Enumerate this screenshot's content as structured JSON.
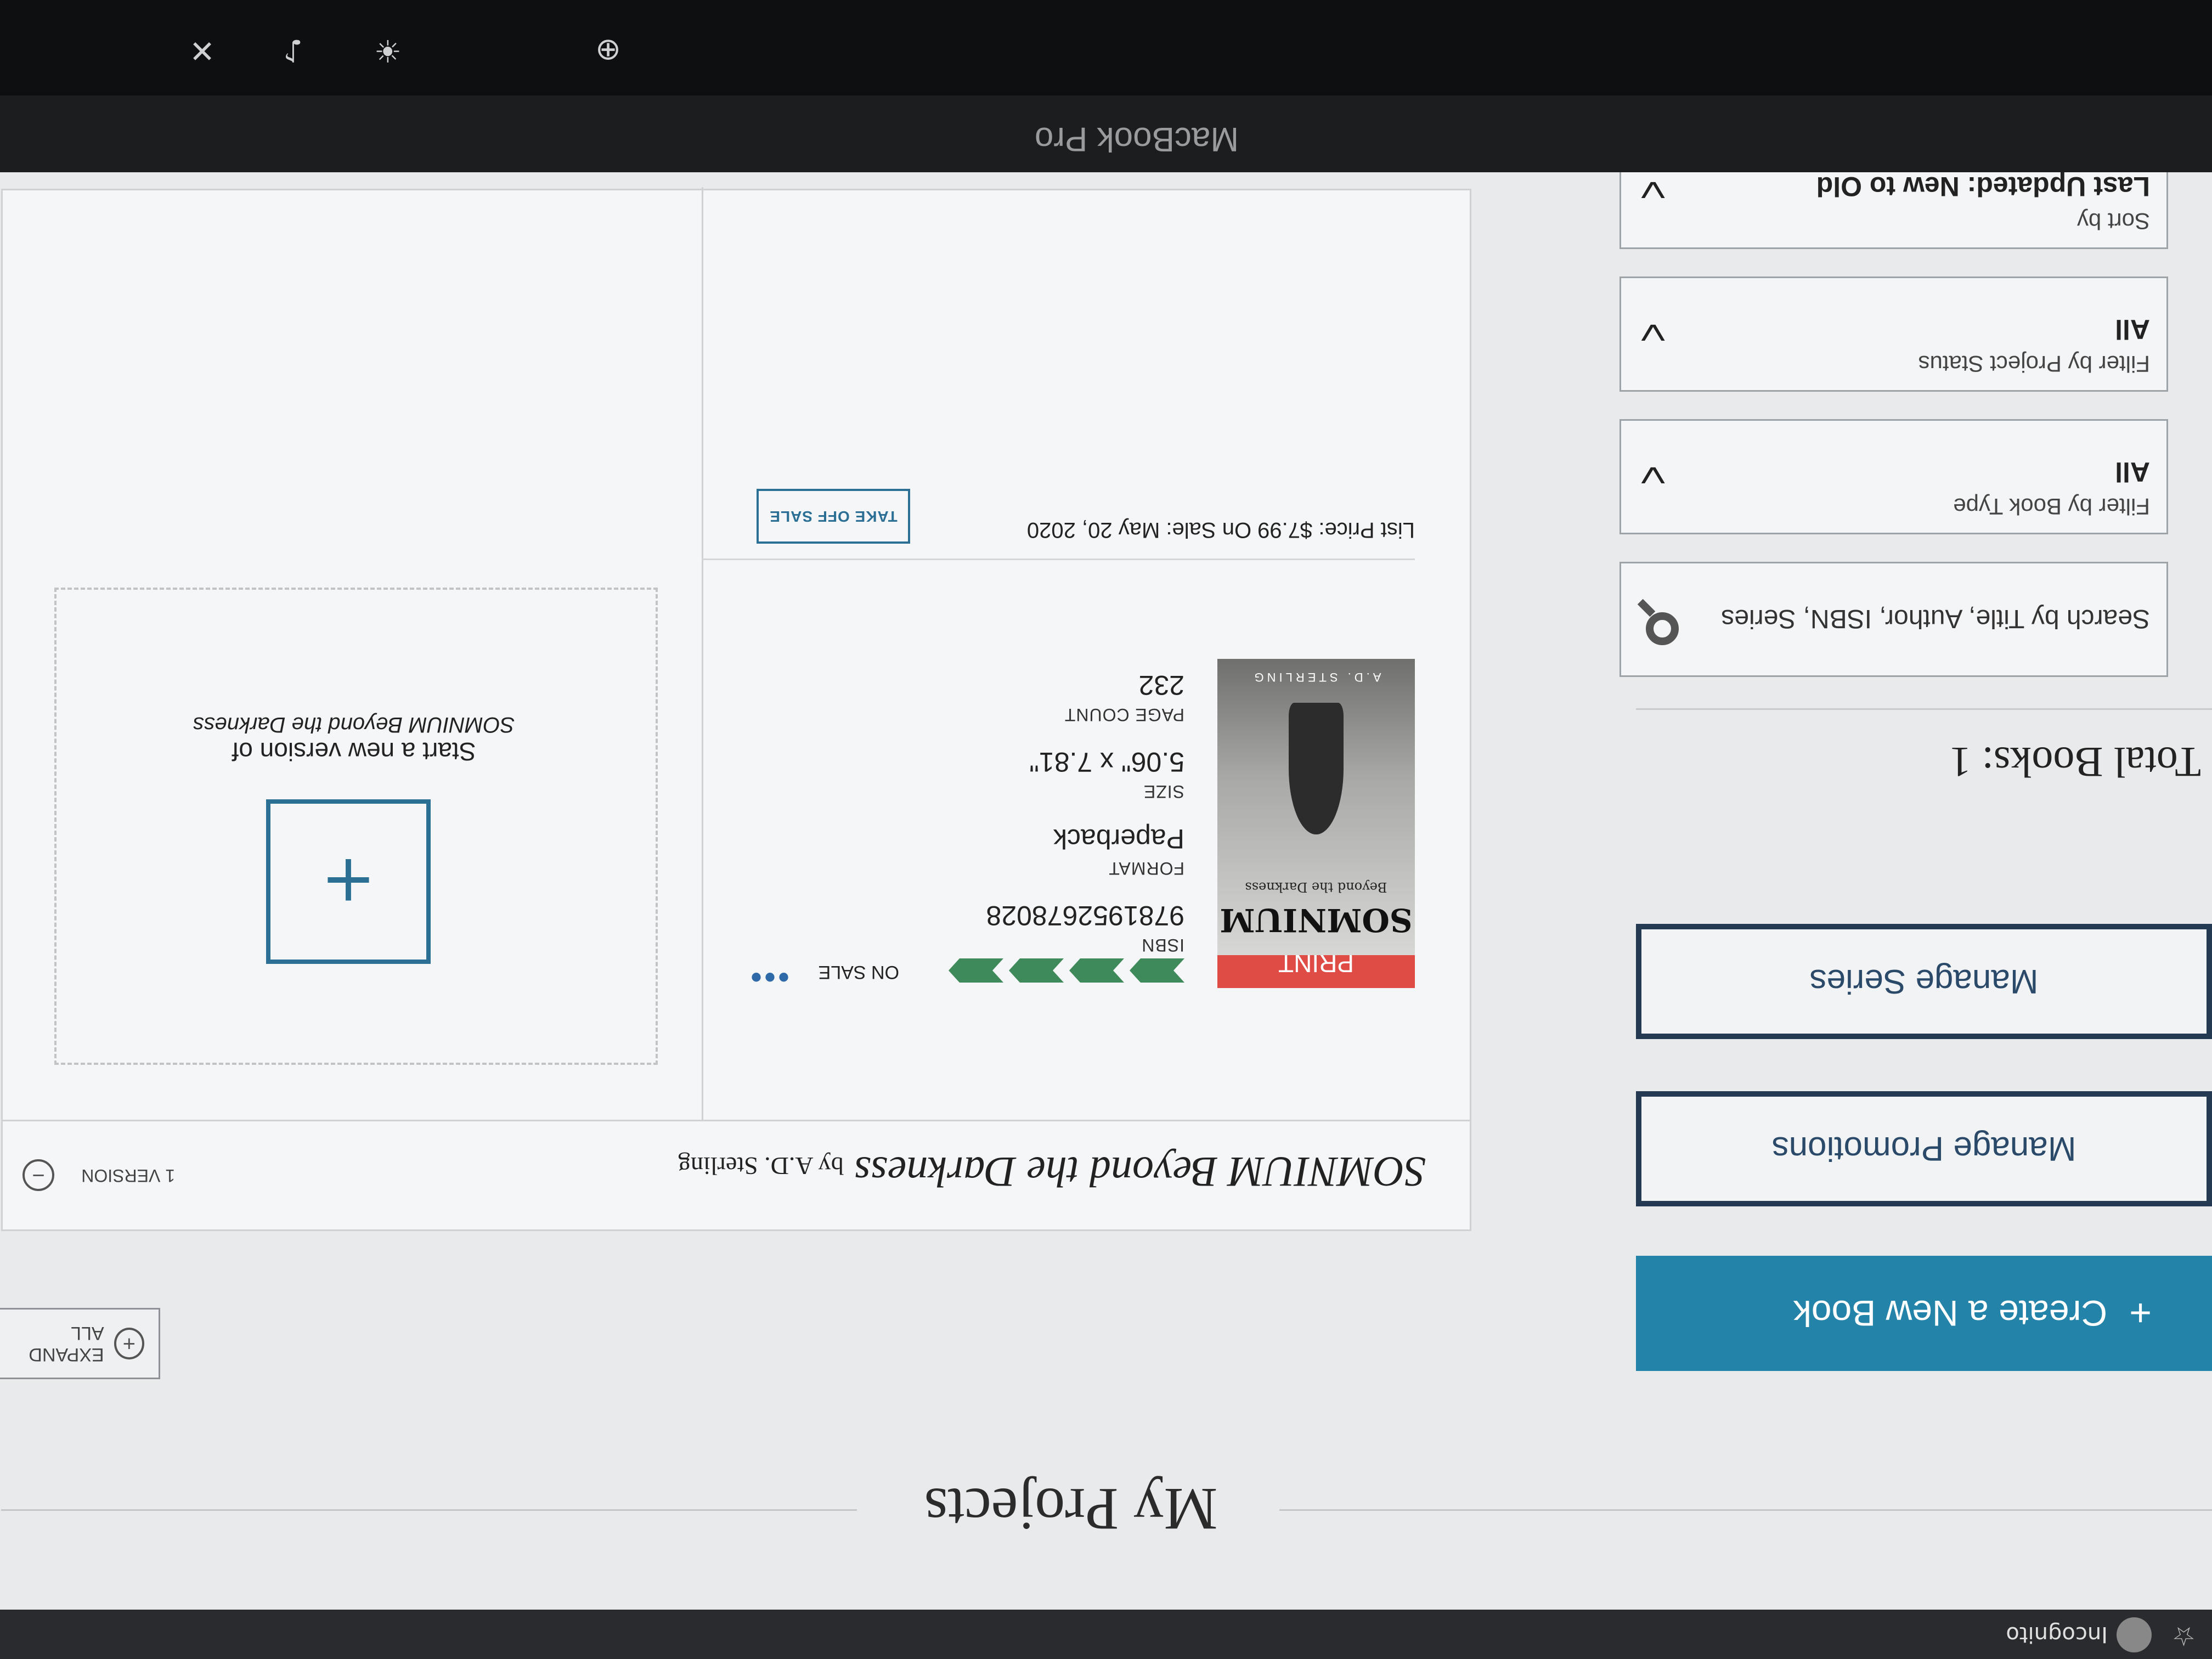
{
  "browser": {
    "incognito_label": "Incognito",
    "star_icon": "star-icon"
  },
  "page": {
    "title": "My Projects",
    "actions": {
      "create": "Create a New Book",
      "promotions": "Manage Promotions",
      "series": "Manage Series"
    },
    "total_books": "Total Books: 1",
    "search": {
      "placeholder": "Search by Title, Author, ISBN, Series"
    },
    "filters": [
      {
        "label": "Filter by Book Type",
        "value": "All"
      },
      {
        "label": "Filter by Project Status",
        "value": "All"
      },
      {
        "label": "Sort by",
        "value": "Last Updated: New to Old"
      }
    ],
    "expand_all": "EXPAND ALL"
  },
  "project": {
    "title": "SOMNIUM Beyond the Darkness",
    "byline": "by A.D. Sterling",
    "version_count": "1 VERSION",
    "card": {
      "format_badge": "PRINT",
      "status": "ON SALE",
      "cover": {
        "title": "SOMNIUM",
        "subtitle": "Beyond the Darkness",
        "author": "A.D. STERLING"
      },
      "meta": [
        {
          "key": "ISBN",
          "value": "9781952678028"
        },
        {
          "key": "FORMAT",
          "value": "Paperback"
        },
        {
          "key": "SIZE",
          "value": "5.06\" x 7.81\""
        },
        {
          "key": "PAGE COUNT",
          "value": "232"
        }
      ],
      "price_text": "List Price: $7.99   On Sale: May 20, 2020",
      "take_off_sale": "TAKE OFF SALE"
    },
    "new_version": {
      "line1": "Start a new version of",
      "line2": "SOMNIUM Beyond the Darkness"
    }
  },
  "device": {
    "label": "MacBook Pro"
  },
  "colors": {
    "accent": "#2383a8",
    "print": "#df4b45",
    "progress": "#3f8a5a",
    "navy": "#233a52"
  }
}
